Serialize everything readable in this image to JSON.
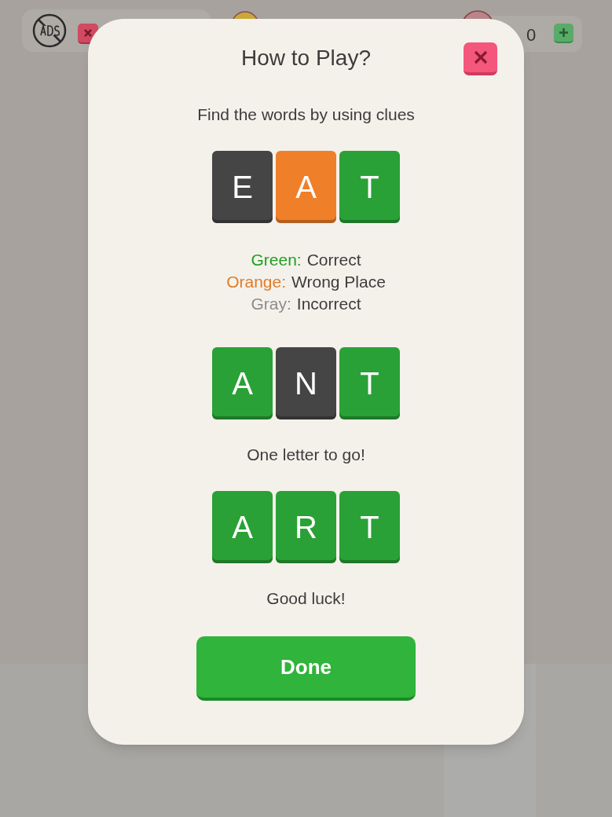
{
  "hud": {
    "count": "0"
  },
  "dialog": {
    "title": "How to Play?",
    "blocks": [
      {
        "kind": "text",
        "text": "Find the words by using clues"
      },
      {
        "kind": "tiles",
        "tiles": [
          {
            "letter": "E",
            "color": "#454545"
          },
          {
            "letter": "A",
            "color": "#f07f2a"
          },
          {
            "letter": "T",
            "color": "#2aa136"
          }
        ]
      },
      {
        "kind": "legend",
        "items": [
          {
            "label": "Green:",
            "color": "#20a020",
            "text": "Correct"
          },
          {
            "label": "Orange:",
            "color": "#e07d28",
            "text": "Wrong Place"
          },
          {
            "label": "Gray:",
            "color": "#8c8c8c",
            "text": "Incorrect"
          }
        ]
      },
      {
        "kind": "tiles",
        "tiles": [
          {
            "letter": "A",
            "color": "#2aa136"
          },
          {
            "letter": "N",
            "color": "#454545"
          },
          {
            "letter": "T",
            "color": "#2aa136"
          }
        ]
      },
      {
        "kind": "text",
        "text": "One letter to go!"
      },
      {
        "kind": "tiles",
        "tiles": [
          {
            "letter": "A",
            "color": "#2aa136"
          },
          {
            "letter": "R",
            "color": "#2aa136"
          },
          {
            "letter": "T",
            "color": "#2aa136"
          }
        ]
      },
      {
        "kind": "text",
        "text": "Good luck!"
      }
    ],
    "button": "Done"
  }
}
